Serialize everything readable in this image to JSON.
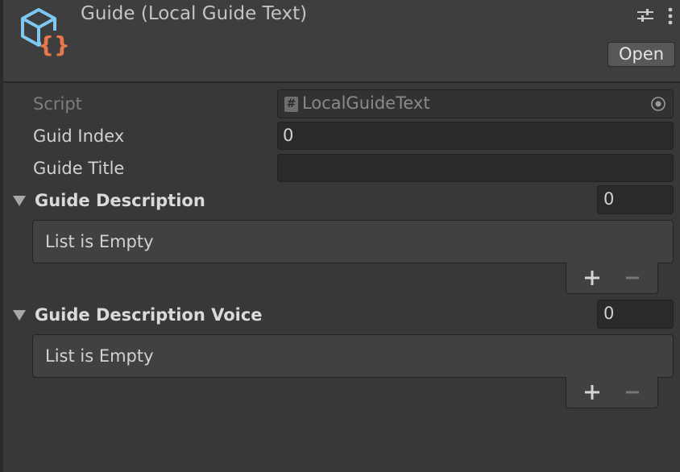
{
  "header": {
    "title": "Guide (Local Guide Text)",
    "open_label": "Open",
    "icons": [
      "script-icon",
      "presets-icon",
      "kebab-menu-icon"
    ]
  },
  "fields": {
    "script": {
      "label": "Script",
      "value": "LocalGuideText"
    },
    "guid_index": {
      "label": "Guid Index",
      "value": "0"
    },
    "guide_title": {
      "label": "Guide Title",
      "value": ""
    }
  },
  "lists": [
    {
      "label": "Guide Description",
      "size": "0",
      "empty_text": "List is Empty"
    },
    {
      "label": "Guide Description Voice",
      "size": "0",
      "empty_text": "List is Empty"
    }
  ],
  "colors": {
    "icon_blue": "#7ec8f2",
    "icon_orange": "#e8784a",
    "panel": "#383838",
    "field": "#2a2a2a"
  }
}
